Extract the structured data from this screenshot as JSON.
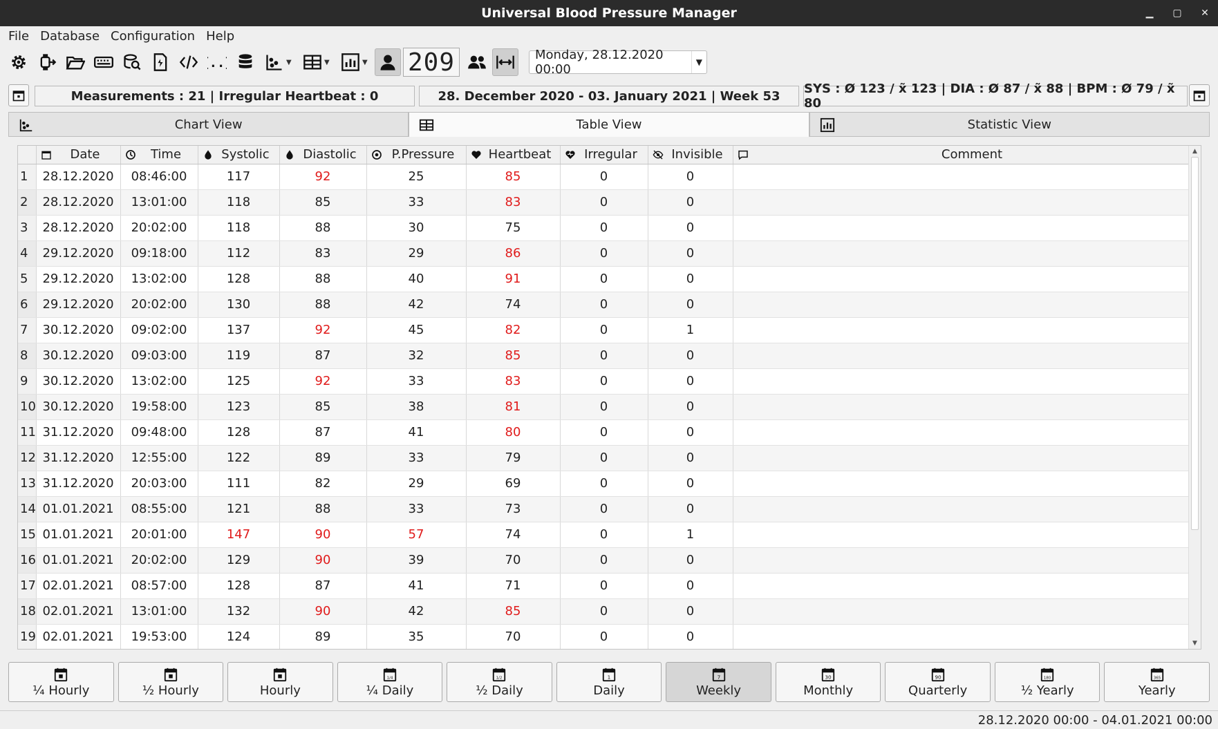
{
  "window": {
    "title": "Universal Blood Pressure Manager"
  },
  "menu": [
    "File",
    "Database",
    "Configuration",
    "Help"
  ],
  "toolbar": {
    "user_counter": "209",
    "date_selector": "Monday, 28.12.2020 00:00"
  },
  "info": {
    "measurements": "Measurements : 21  |  Irregular Heartbeat : 0",
    "range": "28. December 2020 - 03. January 2021  |  Week 53",
    "averages": "SYS : Ø 123 / x̃ 123  |  DIA : Ø 87 / x̃ 88  |  BPM : Ø 79 / x̃ 80"
  },
  "tabs": [
    {
      "label": "Chart View",
      "icon": "scatter-chart-icon"
    },
    {
      "label": "Table View",
      "icon": "table-icon"
    },
    {
      "label": "Statistic View",
      "icon": "bar-chart-icon"
    }
  ],
  "table": {
    "columns": [
      "Date",
      "Time",
      "Systolic",
      "Diastolic",
      "P.Pressure",
      "Heartbeat",
      "Irregular",
      "Invisible",
      "Comment"
    ],
    "rows": [
      [
        "28.12.2020",
        "08:46:00",
        "117",
        "92",
        "25",
        "85",
        "0",
        "0",
        ""
      ],
      [
        "28.12.2020",
        "13:01:00",
        "118",
        "85",
        "33",
        "83",
        "0",
        "0",
        ""
      ],
      [
        "28.12.2020",
        "20:02:00",
        "118",
        "88",
        "30",
        "75",
        "0",
        "0",
        ""
      ],
      [
        "29.12.2020",
        "09:18:00",
        "112",
        "83",
        "29",
        "86",
        "0",
        "0",
        ""
      ],
      [
        "29.12.2020",
        "13:02:00",
        "128",
        "88",
        "40",
        "91",
        "0",
        "0",
        ""
      ],
      [
        "29.12.2020",
        "20:02:00",
        "130",
        "88",
        "42",
        "74",
        "0",
        "0",
        ""
      ],
      [
        "30.12.2020",
        "09:02:00",
        "137",
        "92",
        "45",
        "82",
        "0",
        "1",
        ""
      ],
      [
        "30.12.2020",
        "09:03:00",
        "119",
        "87",
        "32",
        "85",
        "0",
        "0",
        ""
      ],
      [
        "30.12.2020",
        "13:02:00",
        "125",
        "92",
        "33",
        "83",
        "0",
        "0",
        ""
      ],
      [
        "30.12.2020",
        "19:58:00",
        "123",
        "85",
        "38",
        "81",
        "0",
        "0",
        ""
      ],
      [
        "31.12.2020",
        "09:48:00",
        "128",
        "87",
        "41",
        "80",
        "0",
        "0",
        ""
      ],
      [
        "31.12.2020",
        "12:55:00",
        "122",
        "89",
        "33",
        "79",
        "0",
        "0",
        ""
      ],
      [
        "31.12.2020",
        "20:03:00",
        "111",
        "82",
        "29",
        "69",
        "0",
        "0",
        ""
      ],
      [
        "01.01.2021",
        "08:55:00",
        "121",
        "88",
        "33",
        "73",
        "0",
        "0",
        ""
      ],
      [
        "01.01.2021",
        "20:01:00",
        "147",
        "90",
        "57",
        "74",
        "0",
        "1",
        ""
      ],
      [
        "01.01.2021",
        "20:02:00",
        "129",
        "90",
        "39",
        "70",
        "0",
        "0",
        ""
      ],
      [
        "02.01.2021",
        "08:57:00",
        "128",
        "87",
        "41",
        "71",
        "0",
        "0",
        ""
      ],
      [
        "02.01.2021",
        "13:01:00",
        "132",
        "90",
        "42",
        "85",
        "0",
        "0",
        ""
      ],
      [
        "02.01.2021",
        "19:53:00",
        "124",
        "89",
        "35",
        "70",
        "0",
        "0",
        ""
      ]
    ],
    "red_cells": [
      [
        0,
        3
      ],
      [
        0,
        5
      ],
      [
        1,
        5
      ],
      [
        3,
        5
      ],
      [
        4,
        5
      ],
      [
        6,
        3
      ],
      [
        6,
        5
      ],
      [
        7,
        5
      ],
      [
        8,
        3
      ],
      [
        8,
        5
      ],
      [
        9,
        5
      ],
      [
        10,
        5
      ],
      [
        14,
        2
      ],
      [
        14,
        3
      ],
      [
        14,
        4
      ],
      [
        15,
        3
      ],
      [
        17,
        3
      ],
      [
        17,
        5
      ]
    ]
  },
  "periods": [
    {
      "label": "¼ Hourly",
      "icon_text": ""
    },
    {
      "label": "½ Hourly",
      "icon_text": ""
    },
    {
      "label": "Hourly",
      "icon_text": ""
    },
    {
      "label": "¼ Daily",
      "icon_text": "1/4"
    },
    {
      "label": "½ Daily",
      "icon_text": "1/2"
    },
    {
      "label": "Daily",
      "icon_text": "1"
    },
    {
      "label": "Weekly",
      "icon_text": "7"
    },
    {
      "label": "Monthly",
      "icon_text": "30"
    },
    {
      "label": "Quarterly",
      "icon_text": "90"
    },
    {
      "label": "½ Yearly",
      "icon_text": "180"
    },
    {
      "label": "Yearly",
      "icon_text": "365"
    }
  ],
  "active_period": "Weekly",
  "status": "28.12.2020 00:00 - 04.01.2021 00:00",
  "colors": {
    "alert": "#e01b1b",
    "titlebar": "#2b2b2b"
  }
}
